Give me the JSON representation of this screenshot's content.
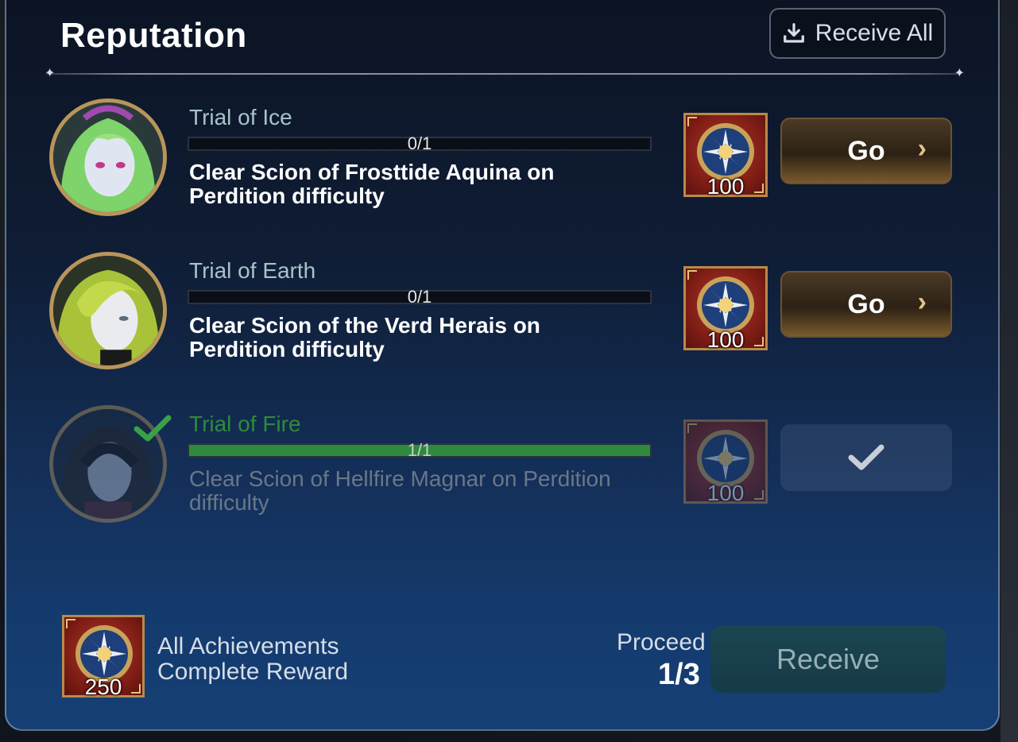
{
  "header": {
    "title": "Reputation",
    "receive_all_label": "Receive All"
  },
  "achievements": [
    {
      "name": "Trial of Ice",
      "progress_text": "0/1",
      "progress": 0,
      "description": "Clear Scion of Frosttide Aquina on Perdition difficulty",
      "reward_qty": "100",
      "action_label": "Go",
      "status": "in-progress"
    },
    {
      "name": "Trial of Earth",
      "progress_text": "0/1",
      "progress": 0,
      "description": "Clear Scion of the Verd Herais on Perdition difficulty",
      "reward_qty": "100",
      "action_label": "Go",
      "status": "in-progress"
    },
    {
      "name": "Trial of Fire",
      "progress_text": "1/1",
      "progress": 1,
      "description": "Clear Scion of Hellfire Magnar on Perdition difficulty",
      "reward_qty": "100",
      "action_label": "",
      "status": "completed"
    }
  ],
  "footer": {
    "reward_label": "All Achievements Complete Reward",
    "reward_qty": "250",
    "proceed_label": "Proceed",
    "proceed_value": "1/3",
    "receive_label": "Receive"
  },
  "icons": {
    "receive_all": "download-tray-icon",
    "reward": "sun-medal-icon",
    "go_chevron": "chevron-right-icon",
    "completed": "checkmark-icon"
  },
  "colors": {
    "accent_gold": "#b8955a",
    "complete_green": "#2e8a3d",
    "panel_blue": "#14325e"
  }
}
